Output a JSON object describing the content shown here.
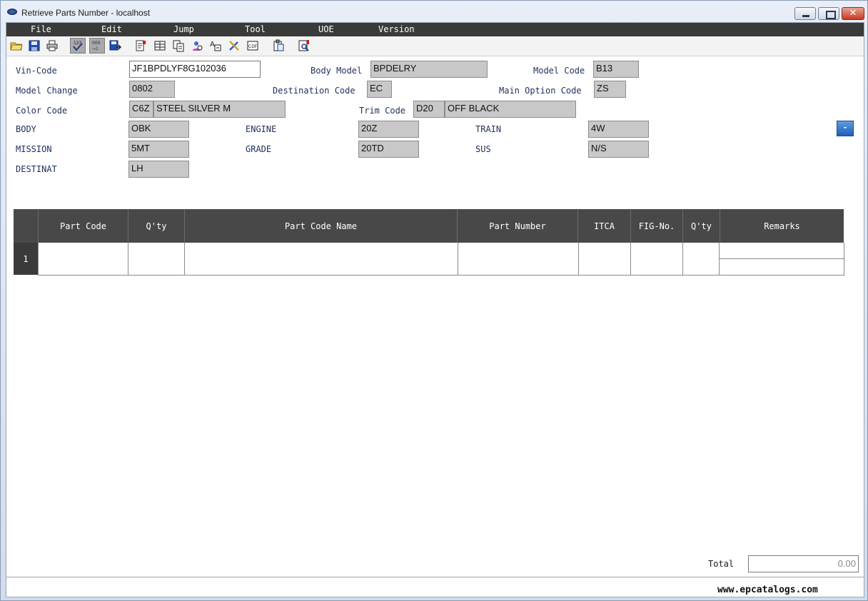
{
  "window": {
    "title": "Retrieve Parts Number - localhost"
  },
  "menu": [
    "File",
    "Edit",
    "Jump",
    "Tool",
    "UOE",
    "Version"
  ],
  "toolbar_icons": [
    "open-folder-icon",
    "save-icon",
    "print-icon",
    "check-numbers-icon",
    "renumber-icon",
    "save-export-icon",
    "note-flag-icon",
    "grid-icon",
    "copy-pages-icon",
    "search-person-icon",
    "text-edit-icon",
    "tools-icon",
    "cdf-icon",
    "clipboard-icon",
    "inspect-doc-icon"
  ],
  "form": {
    "vin_code": {
      "label": "Vin-Code",
      "value": "JF1BPDLYF8G102036"
    },
    "body_model": {
      "label": "Body Model",
      "value": "BPDELRY"
    },
    "model_code": {
      "label": "Model Code",
      "value": "B13"
    },
    "model_change": {
      "label": "Model Change",
      "value": "0802"
    },
    "destination_code": {
      "label": "Destination Code",
      "value": "EC"
    },
    "main_option_code": {
      "label": "Main Option Code",
      "value": "ZS"
    },
    "color_code": {
      "label": "Color Code",
      "code": "C6Z",
      "name": "STEEL SILVER M"
    },
    "trim_code": {
      "label": "Trim Code",
      "code": "D20",
      "name": "OFF BLACK"
    },
    "body": {
      "label": "BODY",
      "value": "OBK"
    },
    "engine": {
      "label": "ENGINE",
      "value": "20Z"
    },
    "train": {
      "label": "TRAIN",
      "value": "4W"
    },
    "mission": {
      "label": "MISSION",
      "value": "5MT"
    },
    "grade": {
      "label": "GRADE",
      "value": "20TD"
    },
    "sus": {
      "label": "SUS",
      "value": "N/S"
    },
    "destinat": {
      "label": "DESTINAT",
      "value": "LH"
    },
    "collapse_button": "-"
  },
  "table": {
    "columns": [
      "Part Code",
      "Q'ty",
      "Part Code Name",
      "Part Number",
      "ITCA",
      "FIG-No.",
      "Q'ty",
      "Remarks"
    ],
    "rows": [
      {
        "index": "1"
      }
    ]
  },
  "footer": {
    "total_label": "Total",
    "total_value": "0.00",
    "watermark": "www.epcatalogs.com"
  }
}
